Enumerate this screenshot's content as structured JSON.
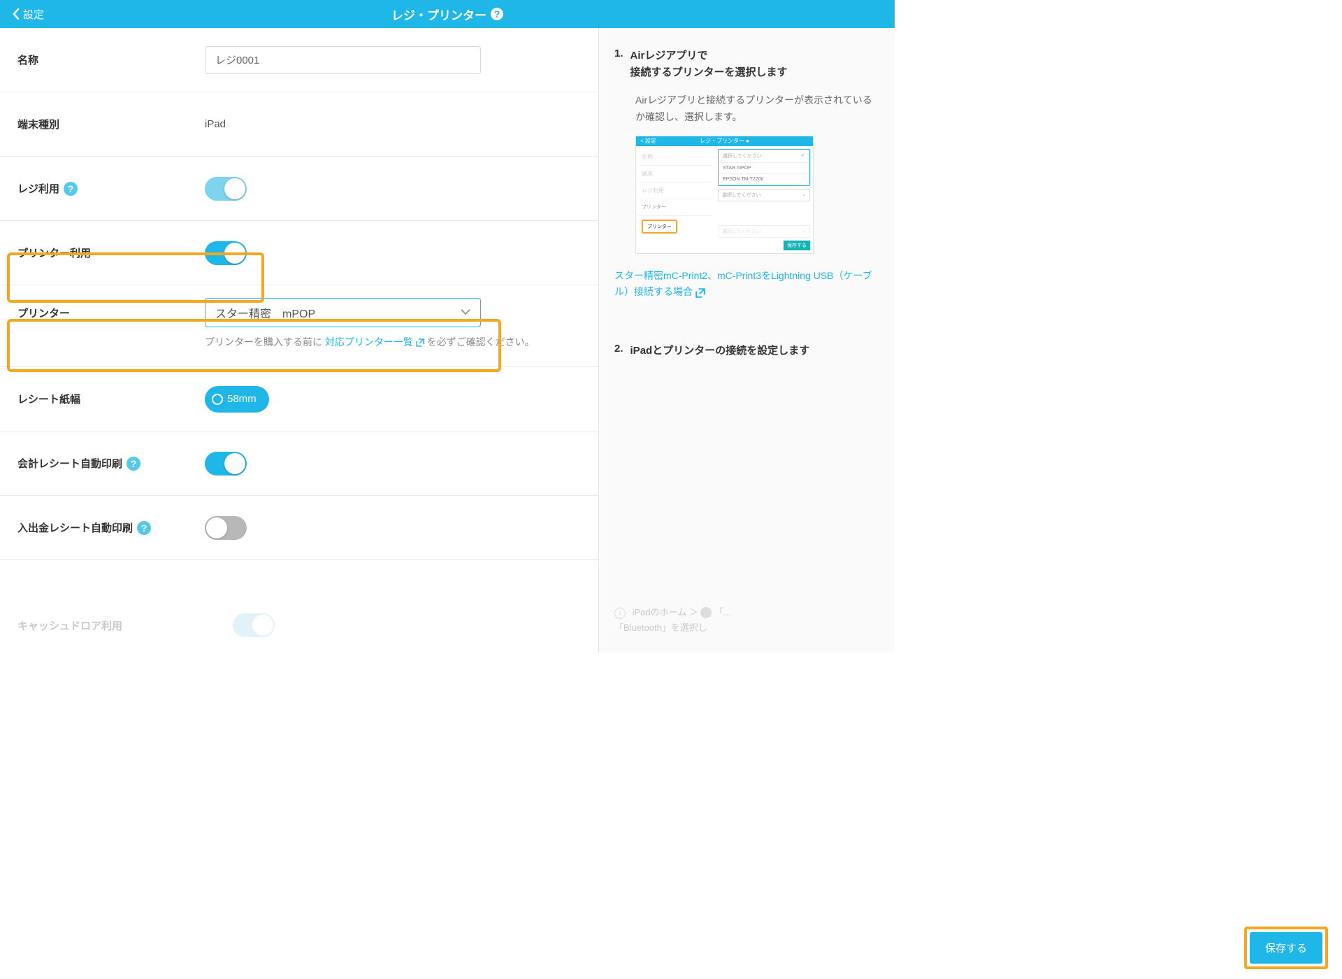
{
  "header": {
    "back": "設定",
    "title": "レジ・プリンター"
  },
  "fields": {
    "name_label": "名称",
    "name_value": "レジ0001",
    "device_label": "端末種別",
    "device_value": "iPad",
    "regi_use_label": "レジ利用",
    "printer_use_label": "プリンター利用",
    "printer_label": "プリンター",
    "printer_value": "スター精密　mPOP",
    "printer_help_pre": "プリンターを購入する前に ",
    "printer_help_link": "対応プリンター一覧",
    "printer_help_post": " を必ずご確認ください。",
    "paper_label": "レシート紙幅",
    "paper_value": "58mm",
    "autoprint_label": "会計レシート自動印刷",
    "cash_autoprint_label": "入出金レシート自動印刷",
    "drawer_label": "キャッシュドロア利用"
  },
  "guide": {
    "step1_num": "1.",
    "step1_title": "Airレジアプリで\n接続するプリンターを選択します",
    "step1_body": "Airレジアプリと接続するプリンターが表示されているか確認し、選択します。",
    "step1_link": "スター精密mC-Print2、mC-Print3をLightning USB（ケーブル）接続する場合",
    "step2_num": "2.",
    "step2_title": "iPadとプリンターの接続を設定します",
    "step2_hint1": "iPadのホーム ＞ ",
    "step2_hint2": "「Bluetooth」を選択し"
  },
  "mini": {
    "title": "レジ・プリンター",
    "back": "< 設定",
    "option_head": "選択してください",
    "option1": "STAR mPOP",
    "option2": "EPSON TM-T220II",
    "option_foot": "選択してください",
    "printer_label": "プリンター",
    "rowlabel": "プリンター"
  },
  "save": "保存する"
}
